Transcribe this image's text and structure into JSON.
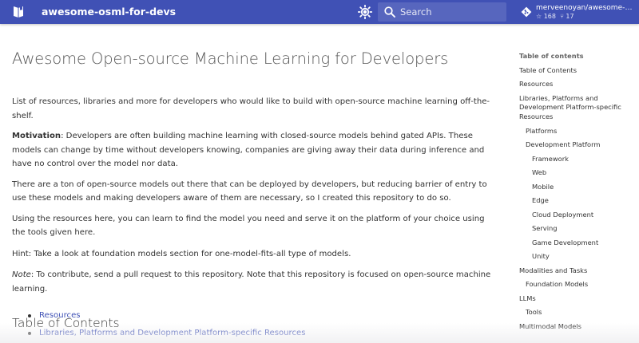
{
  "header": {
    "site_title": "awesome-osml-for-devs",
    "logo_icon": "book-icon",
    "palette_icon": "brightness-icon",
    "search_placeholder": "Search",
    "repo": {
      "name": "merveenoyan/awesome-os…",
      "stars": "☆ 168",
      "forks": "⑂ 17"
    },
    "colors": {
      "primary": "#4051b5",
      "link": "#3f51b5"
    }
  },
  "main": {
    "title": "Awesome Open-source Machine Learning for Developers",
    "intro": "List of resources, libraries and more for developers who would like to build with open-source machine learning off-the-shelf.",
    "motivation_label": "Motivation",
    "motivation_text": ": Developers are often building machine learning with closed-source models behind gated APIs. These models can change by time without developers knowing, companies are giving away their data during inference and have no control over the model nor data.",
    "para3": "There are a ton of open-source models out there that can be deployed by developers, but reducing barrier of entry to use these models and making developers aware of them are necessary, so I created this repository to do so.",
    "para4": "Using the resources here, you can learn to find the model you need and serve it on the platform of your choice using the tools given here.",
    "hint": "Hint: Take a look at foundation models section for one-model-fits-all type of models.",
    "note_label": "Note",
    "note_text": ": To contribute, send a pull request to this repository. Note that this repository is focused on open-source machine learning.",
    "toc_heading": "Table of Contents",
    "toc_items": [
      "Resources",
      "Libraries, Platforms and Development Platform-specific Resources"
    ]
  },
  "sidebar": {
    "title": "Table of contents",
    "items": [
      "Table of Contents",
      "Resources",
      "Libraries, Platforms and Development Platform-specific Resources",
      "Platforms",
      "Development Platform",
      "Framework",
      "Web",
      "Mobile",
      "Edge",
      "Cloud Deployment",
      "Serving",
      "Game Development",
      "Unity",
      "Modalities and Tasks",
      "Foundation Models",
      "LLMs",
      "Tools",
      "Multimodal Models"
    ]
  }
}
